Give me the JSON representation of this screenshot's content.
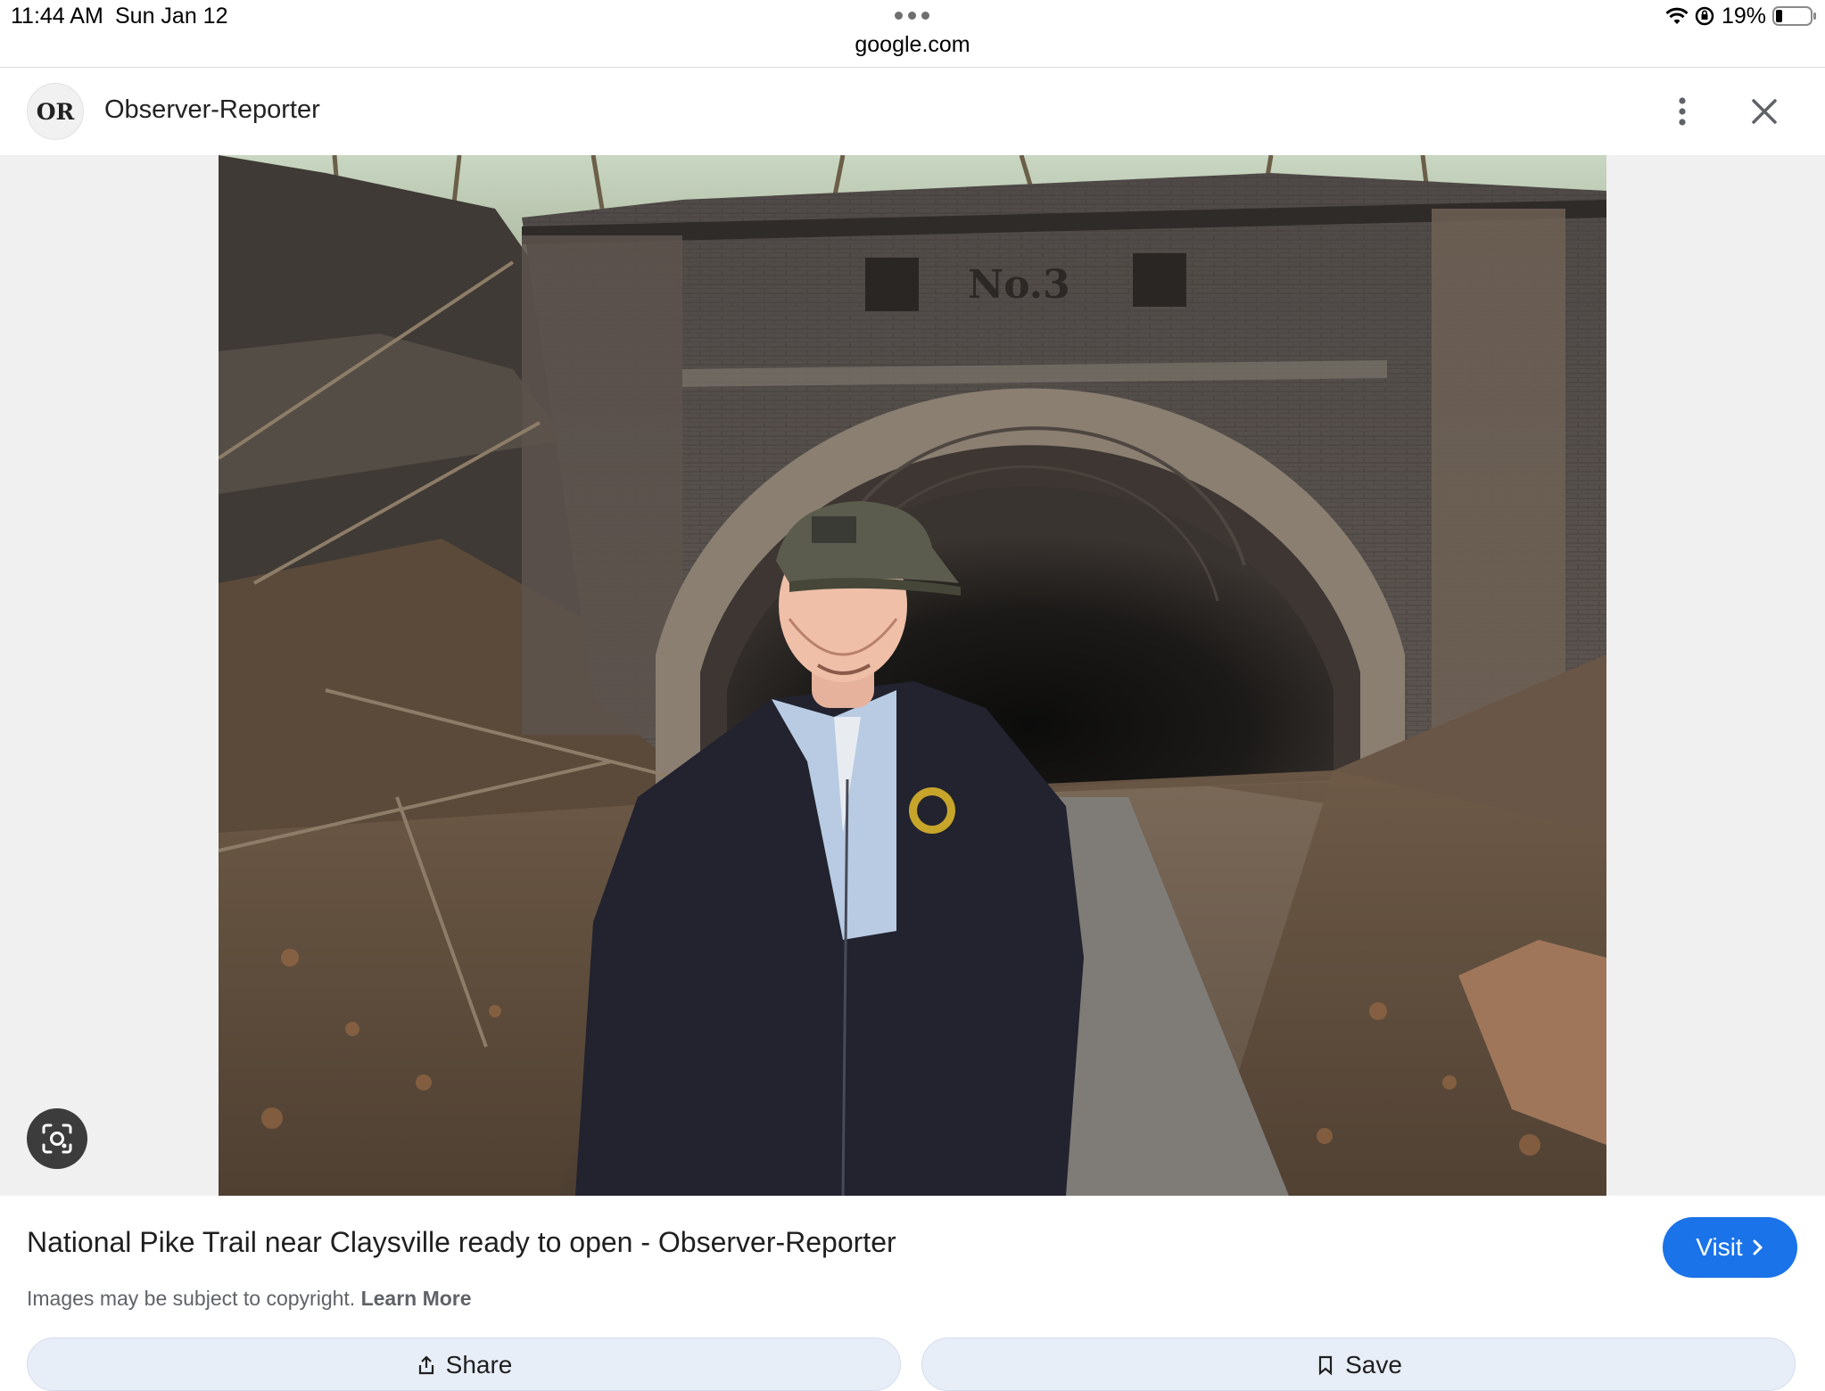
{
  "status_bar": {
    "time": "11:44 AM",
    "date": "Sun Jan 12",
    "url": "google.com",
    "battery": "19%",
    "icons": [
      "wifi-icon",
      "rotation-lock-icon",
      "battery-icon"
    ]
  },
  "header": {
    "source_logo_text": "OR",
    "source_name": "Observer-Reporter",
    "icons": [
      "more-vert-icon",
      "close-icon"
    ]
  },
  "image": {
    "tunnel_sign": "No.3"
  },
  "info": {
    "title": "National Pike Trail near Claysville ready to open - Observer-Reporter",
    "visit_label": "Visit",
    "copyright_text": "Images may be subject to copyright.",
    "learn_more": "Learn More",
    "share_label": "Share",
    "save_label": "Save"
  },
  "colors": {
    "accent": "#1a73e8",
    "stage_bg": "#f0f0f0",
    "lens_button": "#3c3c3c"
  }
}
